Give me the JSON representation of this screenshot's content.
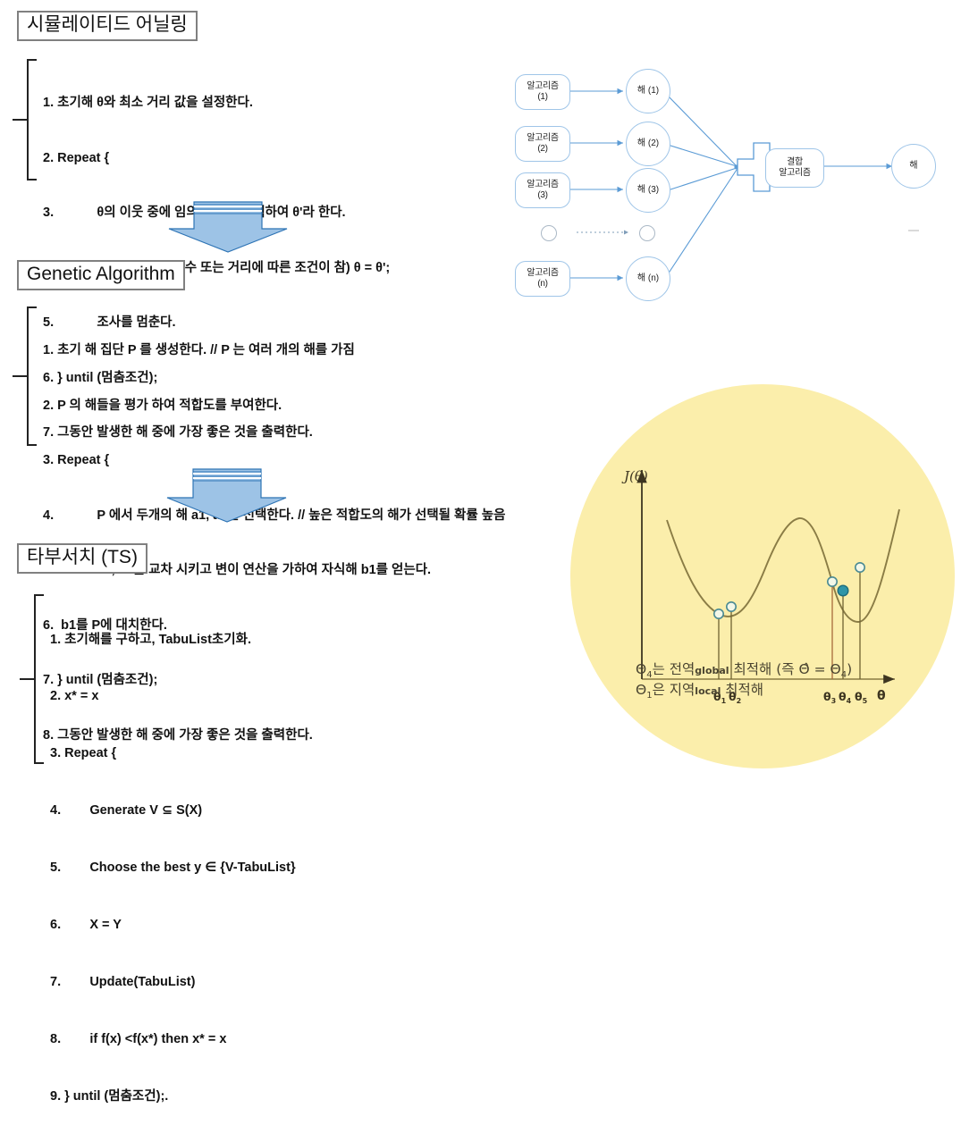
{
  "sections": [
    {
      "id": "simulated-annealing",
      "title": "시뮬레이티드 어닐링",
      "lines": [
        "1. 초기해 θ와 최소 거리 값을 설정한다.",
        "2. Repeat {",
        "3.            θ의 이웃 중에 임의의 해를 선택하여 θ'라 한다.",
        "4.            if(θ'가 θ 보다 우수 또는 거리에 따른 조건이 참) θ = θ';",
        "5.            조사를 멈춘다.",
        "6. } until (멈춤조건);",
        "7. 그동안 발생한 해 중에 가장 좋은 것을 출력한다."
      ]
    },
    {
      "id": "genetic-algorithm",
      "title": "Genetic Algorithm",
      "lines": [
        "1. 초기 해 집단 P 를 생성한다. // P 는 여러 개의 해를 가짐",
        "2. P 의 해들을 평가 하여 적합도를 부여한다.",
        "3. Repeat {",
        "4.            P 에서 두개의 해 a1, a2를 선택한다. // 높은 적합도의 해가 선택될 확률 높음",
        "5.            a1, a2를 교차 시키고 변이 연산을 가하여 자식해 b1를 얻는다.",
        "6.  b1를 P에 대치한다.",
        "7. } until (멈춤조건);",
        "8. 그동안 발생한 해 중에 가장 좋은 것을 출력한다."
      ]
    },
    {
      "id": "tabu-search",
      "title": "타부서치 (TS)",
      "lines": [
        "1. 초기해를 구하고, TabuList초기화.",
        "2. x* = x",
        "3. Repeat {",
        "4.        Generate V ⊆ S(X)",
        "5.        Choose the best y ∈ {V-TabuList}",
        "6.        X = Y",
        "7.        Update(TabuList)",
        "8.        if f(x) <f(x*) then x* = x",
        "9. } until (멈춤조건);."
      ]
    }
  ],
  "arrows": {
    "arrow1_label": "down-arrow-sa-to-ga",
    "arrow2_label": "down-arrow-ga-to-ts",
    "fill": "#9dc3e6",
    "edge": "#2e74b5"
  },
  "node_diagram": {
    "algorithms": [
      {
        "line1": "알고리즘",
        "line2": "(1)"
      },
      {
        "line1": "알고리즘",
        "line2": "(2)"
      },
      {
        "line1": "알고리즘",
        "line2": "(3)"
      },
      {
        "line1": "알고리즘",
        "line2": "(n)"
      }
    ],
    "solutions": [
      {
        "label": "해 (1)"
      },
      {
        "label": "해 (2)"
      },
      {
        "label": "해 (3)"
      },
      {
        "label": "해 (n)"
      }
    ],
    "plus_symbol": "+",
    "combine": {
      "line1": "결합",
      "line2": "알고리즘"
    },
    "final": {
      "label": "해"
    },
    "stroke": "#5b9bd5",
    "node_border": "#9fc5e8"
  },
  "figure": {
    "background": "#fbeeab",
    "axis_y_label": "J(θ)",
    "axis_x_label": "θ",
    "tick_labels": [
      "θ1",
      "θ2",
      "θ3",
      "θ4",
      "θ5"
    ],
    "caption_line1_pre": "Θ",
    "caption_line1": "는 전역",
    "caption_line1_sup": "global",
    "caption_line1_post": " 최적해 (즉 Θ̂ = Θ",
    "caption_line1_end": ")",
    "caption_line2": "은 지역",
    "caption_line2_sup": "local",
    "caption_line2_post": " 최적해",
    "sub4": "4",
    "sub1": "1"
  },
  "chart_data": {
    "type": "line",
    "title": "",
    "xlabel": "θ",
    "ylabel": "J(θ)",
    "grid": false,
    "legend": "none",
    "description": "Double-well objective function J(θ) with two local minima; markers at θ1..θ5 show search iterates, θ4 is the global optimum.",
    "x": [
      0.0,
      0.05,
      0.1,
      0.15,
      0.2,
      0.25,
      0.3,
      0.35,
      0.4,
      0.45,
      0.5,
      0.55,
      0.6,
      0.65,
      0.7,
      0.75,
      0.8,
      0.85,
      0.9,
      0.95,
      1.0
    ],
    "y": [
      0.92,
      0.76,
      0.61,
      0.48,
      0.38,
      0.31,
      0.28,
      0.31,
      0.4,
      0.54,
      0.69,
      0.79,
      0.8,
      0.7,
      0.5,
      0.29,
      0.16,
      0.13,
      0.24,
      0.48,
      0.86
    ],
    "markers": [
      {
        "name": "θ1",
        "x": 0.285,
        "y": 0.285,
        "filled": false
      },
      {
        "name": "θ2",
        "x": 0.335,
        "y": 0.3,
        "filled": false
      },
      {
        "name": "θ3",
        "x": 0.79,
        "y": 0.15,
        "filled": false
      },
      {
        "name": "θ4",
        "x": 0.84,
        "y": 0.128,
        "filled": true
      },
      {
        "name": "θ5",
        "x": 0.905,
        "y": 0.245,
        "filled": false
      }
    ],
    "xlim": [
      0,
      1
    ],
    "ylim": [
      0,
      1
    ]
  }
}
